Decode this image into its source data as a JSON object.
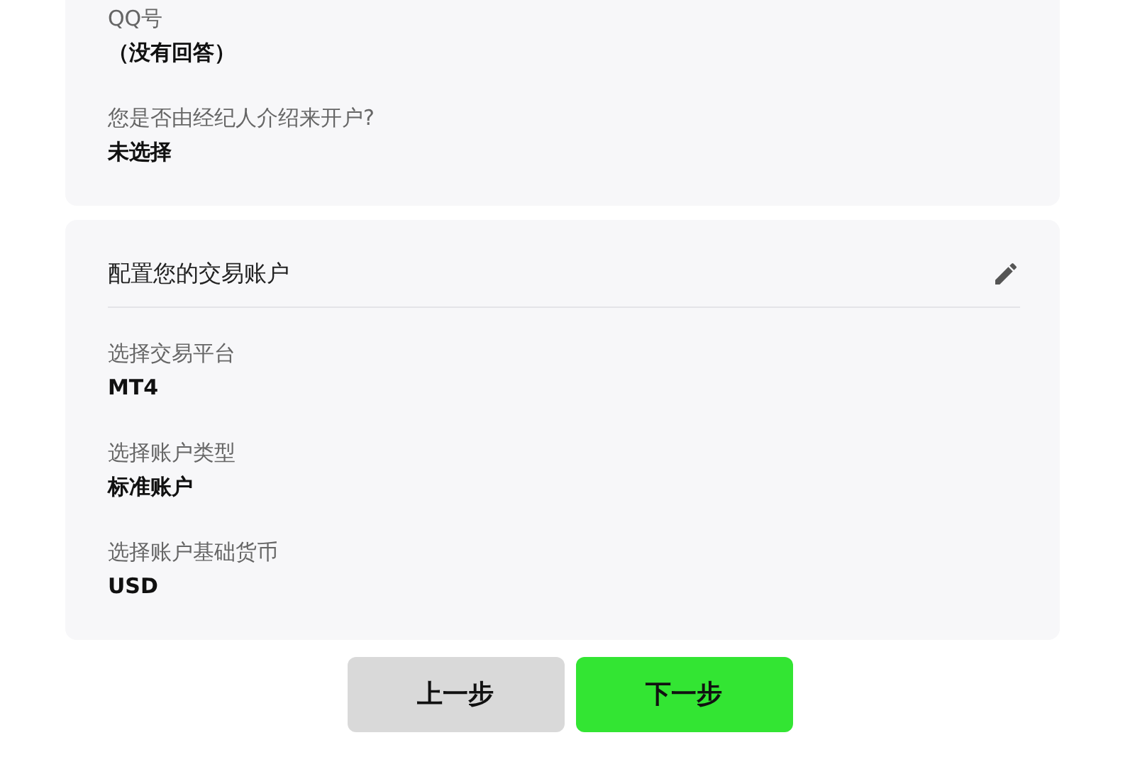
{
  "sections": [
    {
      "fields": [
        {
          "label": "QQ号",
          "value": "（没有回答）"
        },
        {
          "label": "您是否由经纪人介绍来开户?",
          "value": "未选择"
        }
      ]
    },
    {
      "title": "配置您的交易账户",
      "editable": true,
      "fields": [
        {
          "label": "选择交易平台",
          "value": "MT4"
        },
        {
          "label": "选择账户类型",
          "value": "标准账户"
        },
        {
          "label": "选择账户基础货币",
          "value": "USD"
        }
      ]
    }
  ],
  "buttons": [
    {
      "label": "上一步",
      "kind": "secondary"
    },
    {
      "label": "下一步",
      "kind": "primary"
    }
  ]
}
